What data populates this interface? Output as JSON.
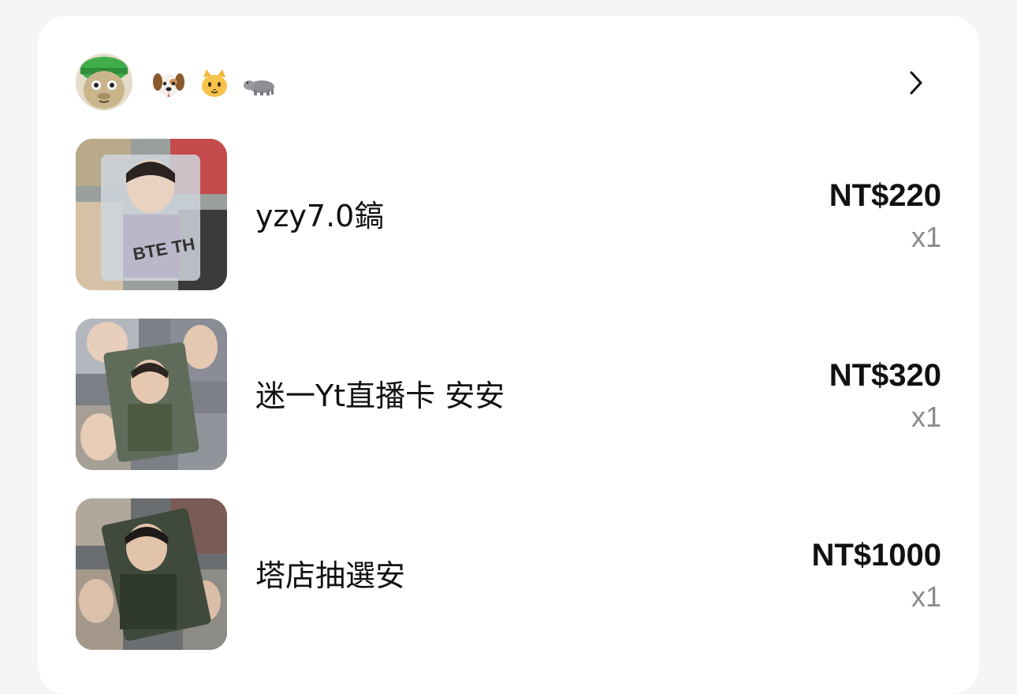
{
  "seller": {
    "avatar_icon": "cartoon-character-avatar",
    "badges": [
      "dog-face-emoji",
      "cat-face-emoji",
      "hippopotamus-emoji"
    ],
    "chevron_icon": "chevron-right-icon"
  },
  "items": [
    {
      "title": "yzy7.0鎬",
      "price": "NT$220",
      "quantity": "x1",
      "thumbnail_icon": "photo-card-thumbnail"
    },
    {
      "title": "迷一Yt直播卡 安安",
      "price": "NT$320",
      "quantity": "x1",
      "thumbnail_icon": "photo-card-thumbnail"
    },
    {
      "title": "塔店抽選安",
      "price": "NT$1000",
      "quantity": "x1",
      "thumbnail_icon": "photo-card-thumbnail"
    }
  ],
  "colors": {
    "background": "#f5f5f5",
    "card": "#ffffff",
    "text_primary": "#111111",
    "text_secondary": "#8a8a8a"
  }
}
